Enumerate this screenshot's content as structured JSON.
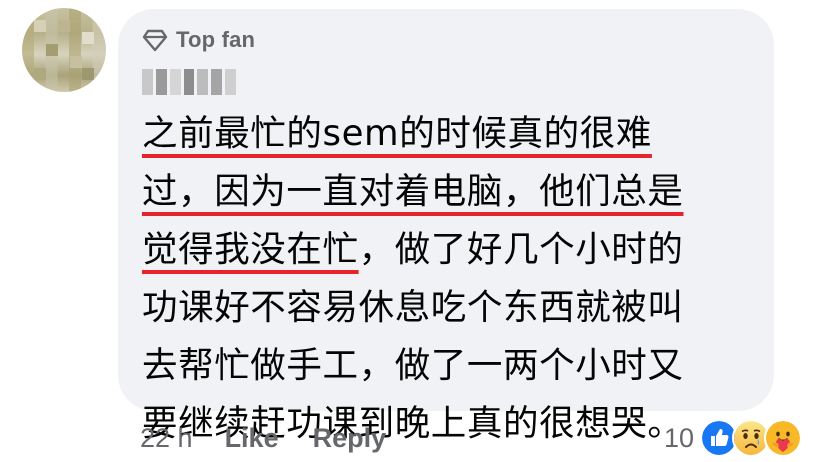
{
  "comment": {
    "badge": {
      "icon": "diamond-icon",
      "label": "Top fan"
    },
    "lines": [
      "之前最忙的sem的时候真的很难",
      "过，因为一直对着电脑，他们总是",
      "觉得我没在忙，做了好几个小时的",
      "功课好不容易休息吃个东西就被叫",
      "去帮忙做手工，做了一两个小时又",
      "要继续赶功课到晚上真的很想哭。"
    ],
    "highlight_color": "#e4252c"
  },
  "actions": {
    "time": "22 h",
    "like": "Like",
    "reply": "Reply"
  },
  "reactions": {
    "count": "10",
    "icons": [
      "like-reaction-icon",
      "sad-reaction-icon",
      "care-reaction-icon"
    ]
  },
  "colors": {
    "bubble": "#f0f2f5",
    "secondary_text": "#65676b",
    "like_blue": "#1877f2"
  }
}
